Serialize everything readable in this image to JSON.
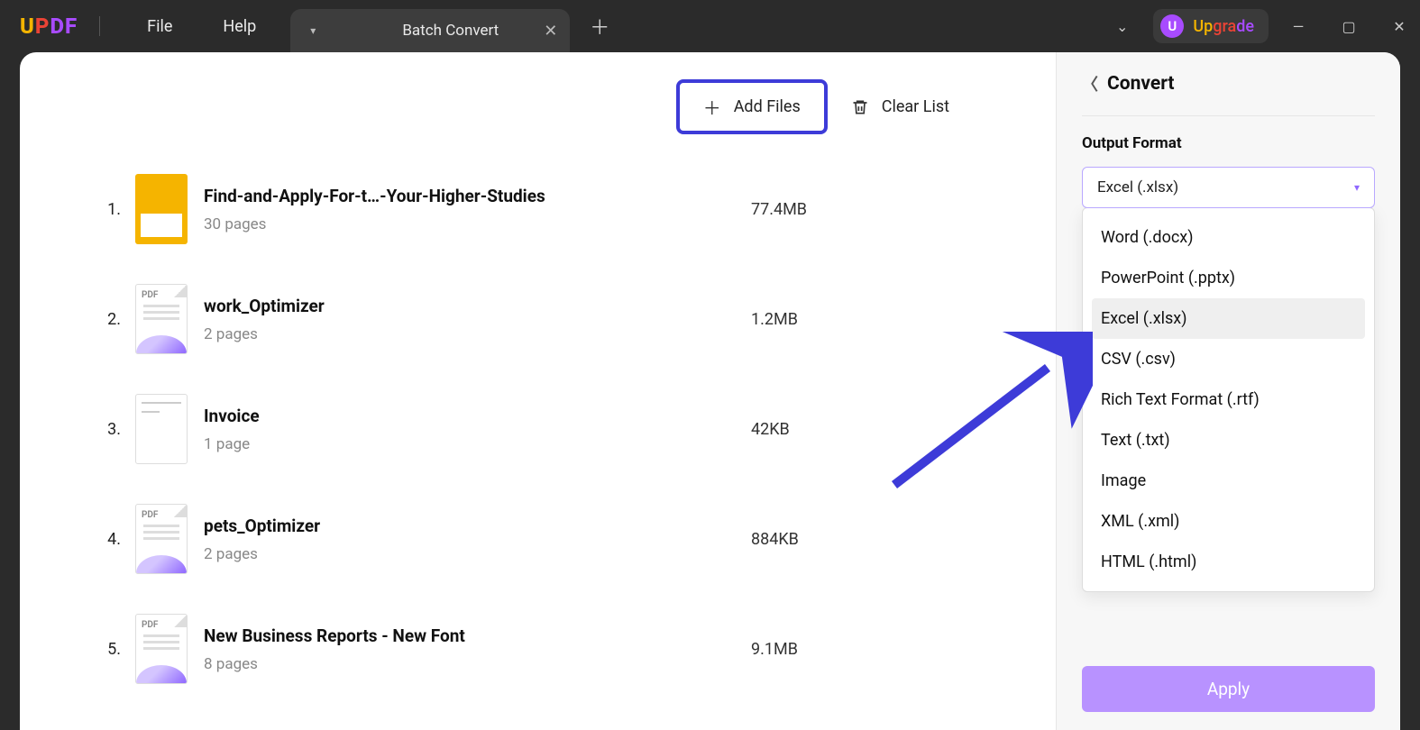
{
  "topbar": {
    "logo_text": "UPDF",
    "menu": {
      "file": "File",
      "help": "Help"
    },
    "tab": {
      "title": "Batch Convert"
    },
    "upgrade": {
      "avatar": "U",
      "label": "Upgrade"
    }
  },
  "actions": {
    "add_files": "Add Files",
    "clear_list": "Clear List"
  },
  "files": [
    {
      "index": "1.",
      "name": "Find-and-Apply-For-t…-Your-Higher-Studies",
      "pages": "30 pages",
      "size": "77.4MB",
      "thumb": "yellow"
    },
    {
      "index": "2.",
      "name": "work_Optimizer",
      "pages": "2 pages",
      "size": "1.2MB",
      "thumb": "pdf"
    },
    {
      "index": "3.",
      "name": "Invoice",
      "pages": "1 page",
      "size": "42KB",
      "thumb": "invoice"
    },
    {
      "index": "4.",
      "name": "pets_Optimizer",
      "pages": "2 pages",
      "size": "884KB",
      "thumb": "pdf"
    },
    {
      "index": "5.",
      "name": "New Business Reports - New Font",
      "pages": "8 pages",
      "size": "9.1MB",
      "thumb": "pdf"
    }
  ],
  "panel": {
    "title": "Convert",
    "output_format_label": "Output Format",
    "selected_format": "Excel (.xlsx)",
    "options": [
      "Word (.docx)",
      "PowerPoint (.pptx)",
      "Excel (.xlsx)",
      "CSV (.csv)",
      "Rich Text Format (.rtf)",
      "Text (.txt)",
      "Image",
      "XML (.xml)",
      "HTML (.html)"
    ],
    "highlight_index": 2,
    "apply": "Apply"
  }
}
